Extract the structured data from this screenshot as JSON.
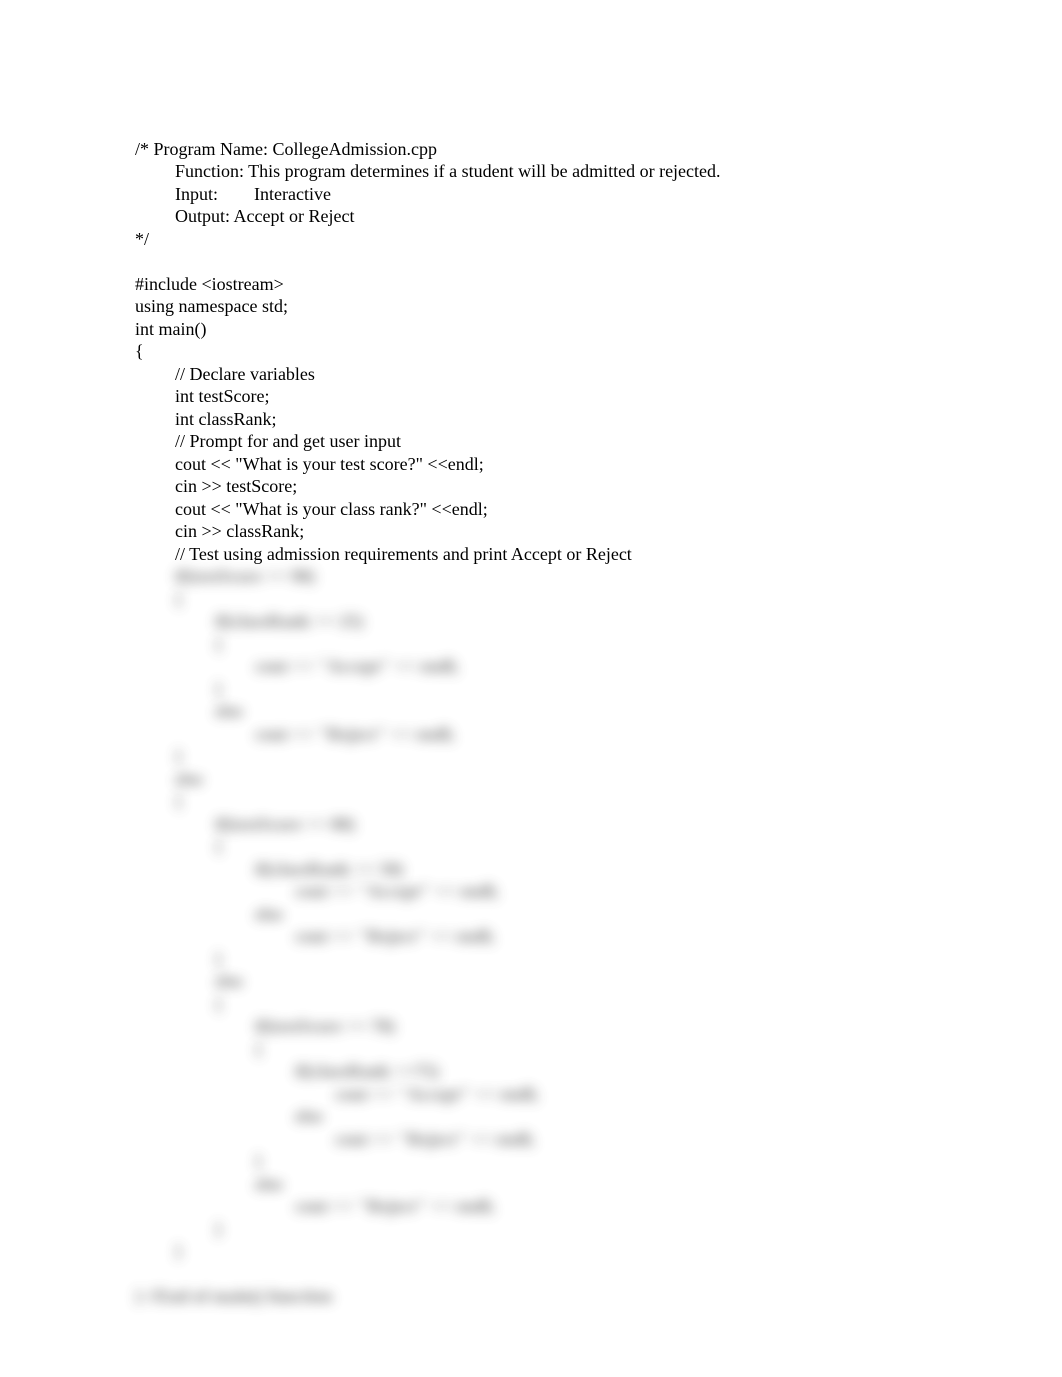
{
  "code": {
    "lines": [
      {
        "text": "/* Program Name: CollegeAdmission.cpp",
        "indent": 0,
        "blurred": false
      },
      {
        "text": "Function: This program determines if a student will be admitted or rejected.",
        "indent": 1,
        "blurred": false
      },
      {
        "text": "Input:        Interactive",
        "indent": 1,
        "blurred": false
      },
      {
        "text": "Output: Accept or Reject",
        "indent": 1,
        "blurred": false
      },
      {
        "text": "*/",
        "indent": 0,
        "blurred": false
      },
      {
        "text": "",
        "indent": 0,
        "blurred": false
      },
      {
        "text": "#include <iostream>",
        "indent": 0,
        "blurred": false
      },
      {
        "text": "using namespace std;",
        "indent": 0,
        "blurred": false
      },
      {
        "text": "int main()",
        "indent": 0,
        "blurred": false
      },
      {
        "text": "{",
        "indent": 0,
        "blurred": false
      },
      {
        "text": "// Declare variables",
        "indent": 1,
        "blurred": false
      },
      {
        "text": "int testScore;",
        "indent": 1,
        "blurred": false
      },
      {
        "text": "int classRank;",
        "indent": 1,
        "blurred": false
      },
      {
        "text": "// Prompt for and get user input",
        "indent": 1,
        "blurred": false
      },
      {
        "text": "cout << \"What is your test score?\" <<endl;",
        "indent": 1,
        "blurred": false
      },
      {
        "text": "cin >> testScore;",
        "indent": 1,
        "blurred": false
      },
      {
        "text": "cout << \"What is your class rank?\" <<endl;",
        "indent": 1,
        "blurred": false
      },
      {
        "text": "cin >> classRank;",
        "indent": 1,
        "blurred": false
      },
      {
        "text": "// Test using admission requirements and print Accept or Reject",
        "indent": 1,
        "blurred": false
      },
      {
        "text": "if(testScore >= 90)",
        "indent": 1,
        "blurred": true
      },
      {
        "text": "{",
        "indent": 1,
        "blurred": true
      },
      {
        "text": "if(classRank >= 25)",
        "indent": 2,
        "blurred": true
      },
      {
        "text": "{",
        "indent": 2,
        "blurred": true
      },
      {
        "text": "cout << \"Accept\" << endl;",
        "indent": 3,
        "blurred": true
      },
      {
        "text": "}",
        "indent": 2,
        "blurred": true
      },
      {
        "text": "else",
        "indent": 2,
        "blurred": true
      },
      {
        "text": "cout << \"Reject\" << endl;",
        "indent": 3,
        "blurred": true
      },
      {
        "text": "}",
        "indent": 1,
        "blurred": true
      },
      {
        "text": "else",
        "indent": 1,
        "blurred": true
      },
      {
        "text": "{",
        "indent": 1,
        "blurred": true
      },
      {
        "text": "if(testScore >= 80)",
        "indent": 2,
        "blurred": true
      },
      {
        "text": "{",
        "indent": 2,
        "blurred": true
      },
      {
        "text": "if(classRank >= 50)",
        "indent": 3,
        "blurred": true
      },
      {
        "text": "cout << \"Accept\" << endl;",
        "indent": 4,
        "blurred": true
      },
      {
        "text": "else",
        "indent": 3,
        "blurred": true
      },
      {
        "text": "cout << \"Reject\" << endl;",
        "indent": 4,
        "blurred": true
      },
      {
        "text": "}",
        "indent": 2,
        "blurred": true
      },
      {
        "text": "else",
        "indent": 2,
        "blurred": true
      },
      {
        "text": "{",
        "indent": 2,
        "blurred": true
      },
      {
        "text": "if(testScore >= 70)",
        "indent": 3,
        "blurred": true
      },
      {
        "text": "{",
        "indent": 3,
        "blurred": true
      },
      {
        "text": "if(classRank >=75)",
        "indent": 4,
        "blurred": true
      },
      {
        "text": "cout << \"Accept\" << endl;",
        "indent": 5,
        "blurred": true
      },
      {
        "text": "else",
        "indent": 4,
        "blurred": true
      },
      {
        "text": "cout << \"Reject\" << endl;",
        "indent": 5,
        "blurred": true
      },
      {
        "text": "}",
        "indent": 3,
        "blurred": true
      },
      {
        "text": "else",
        "indent": 3,
        "blurred": true
      },
      {
        "text": "cout << \"Reject\" << endl;",
        "indent": 4,
        "blurred": true
      },
      {
        "text": "}",
        "indent": 2,
        "blurred": true
      },
      {
        "text": "}",
        "indent": 1,
        "blurred": true
      },
      {
        "text": "",
        "indent": 0,
        "blurred": false
      },
      {
        "text": "} //End of main() function",
        "indent": 0,
        "blurred": true
      }
    ]
  }
}
